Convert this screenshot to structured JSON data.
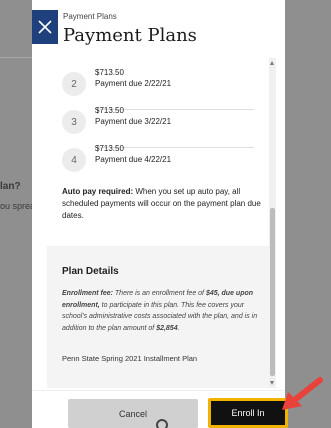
{
  "background": {
    "partial_heading": "lan?",
    "partial_text": "ou spread ou"
  },
  "drawer": {
    "eyebrow": "Payment Plans",
    "title": "Payment Plans",
    "payments": [
      {
        "number": "2",
        "amount": "$713.50",
        "due": "Payment due 2/22/21"
      },
      {
        "number": "3",
        "amount": "$713.50",
        "due": "Payment due 3/22/21"
      },
      {
        "number": "4",
        "amount": "$713.50",
        "due": "Payment due 4/22/21"
      }
    ],
    "autopay_label": "Auto pay required:",
    "autopay_text": " When you set up auto pay, all scheduled payments will occur on the payment plan due dates.",
    "plan_details_title": "Plan Details",
    "plan_fee_label": "Enrollment fee:",
    "plan_fee_text_1": " There is an enrollment fee of ",
    "plan_fee_amount": "$45, due upon enrollment,",
    "plan_fee_text_2": " to participate in this plan. This fee covers your school's administrative costs associated with the plan, and is in addition to the plan amount of ",
    "plan_amount": "$2,854",
    "plan_fee_end": ".",
    "plan_name": "Penn State Spring 2021 Installment Plan"
  },
  "footer": {
    "cancel_label": "Cancel",
    "enroll_label": "Enroll In"
  },
  "colors": {
    "close_button": "#1e407c",
    "highlight_border": "#f2b300",
    "arrow": "#e8423a"
  }
}
